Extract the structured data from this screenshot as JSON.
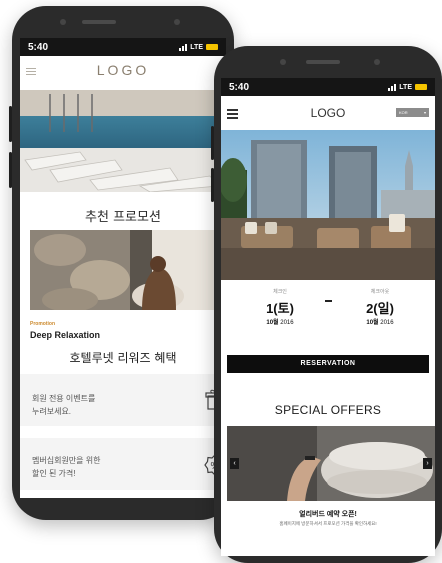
{
  "back_phone": {
    "status_time": "5:40",
    "status_net": "LTE",
    "logo": "LOGO",
    "promo_section_title": "추천 프로모션",
    "promo_tag": "Promotion",
    "promo_name": "Deep Relaxation",
    "promo_name_kr": "호텔루넷 리워즈 혜택",
    "benefits": [
      {
        "line1": "회원 전용 이벤트를",
        "line2": "누려보세요.",
        "icon": "gift-icon"
      },
      {
        "line1": "멤버십회원만을 위한",
        "line2": "할인 된 가격!",
        "icon": "percent-badge-icon"
      }
    ]
  },
  "front_phone": {
    "status_time": "5:40",
    "status_net": "LTE",
    "logo": "LOGO",
    "language": "KOR",
    "checkin": {
      "label": "체크인",
      "day": "1(토)",
      "month": "10월",
      "year": "2016"
    },
    "checkout": {
      "label": "체크아웃",
      "day": "2(일)",
      "month": "10월",
      "year": "2016"
    },
    "reservation_label": "RESERVATION",
    "special_offers_title": "SPECIAL OFFERS",
    "offer_title": "얼리버드 예약 오픈!",
    "offer_desc": "홈페이지에 방문하셔서 프로모션 가격을 확인하세요!",
    "prev_arrow": "‹",
    "next_arrow": "›"
  },
  "colors": {
    "accent": "#cc8a2e",
    "dark": "#0d0d0d",
    "battery": "#f5c400"
  }
}
